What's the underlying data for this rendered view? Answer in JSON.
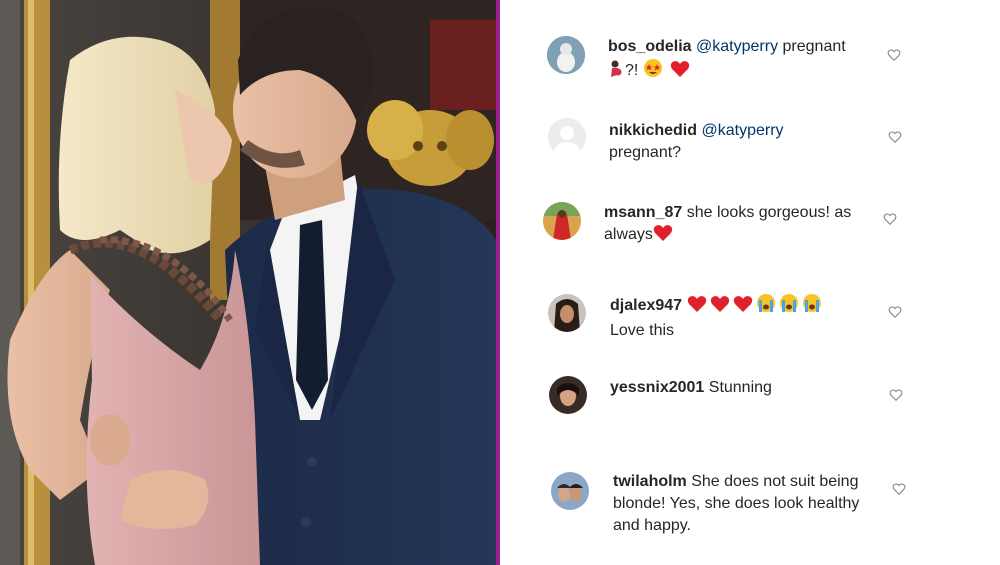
{
  "photo": {
    "alt": "couple-kissing-photo"
  },
  "comments": [
    {
      "username": "bos_odelia",
      "mention": "@katyperry",
      "text": " pregnant",
      "tail": "?! ",
      "emojis": [
        "pregnant-woman",
        "star-struck",
        "red-heart"
      ]
    },
    {
      "username": "nikkichedid",
      "mention": "@katyperry",
      "text": "pregnant?",
      "emojis": []
    },
    {
      "username": "msann_87",
      "mention": "",
      "text": "she looks gorgeous! as always",
      "emojis": [
        "red-heart"
      ]
    },
    {
      "username": "djalex947",
      "mention": "",
      "text": "Love this",
      "emojis": [
        "red-heart",
        "red-heart",
        "red-heart",
        "crying-face",
        "crying-face",
        "crying-face"
      ]
    },
    {
      "username": "yessnix2001",
      "mention": "",
      "text": "Stunning",
      "emojis": []
    },
    {
      "username": "twilaholm",
      "mention": "",
      "text": "She does not suit being blonde! Yes, she does look healthy and happy.",
      "emojis": []
    }
  ],
  "colors": {
    "divider": "#9b1f8f",
    "mention": "#00376b",
    "text": "#262626",
    "heart": "#e0202a"
  }
}
